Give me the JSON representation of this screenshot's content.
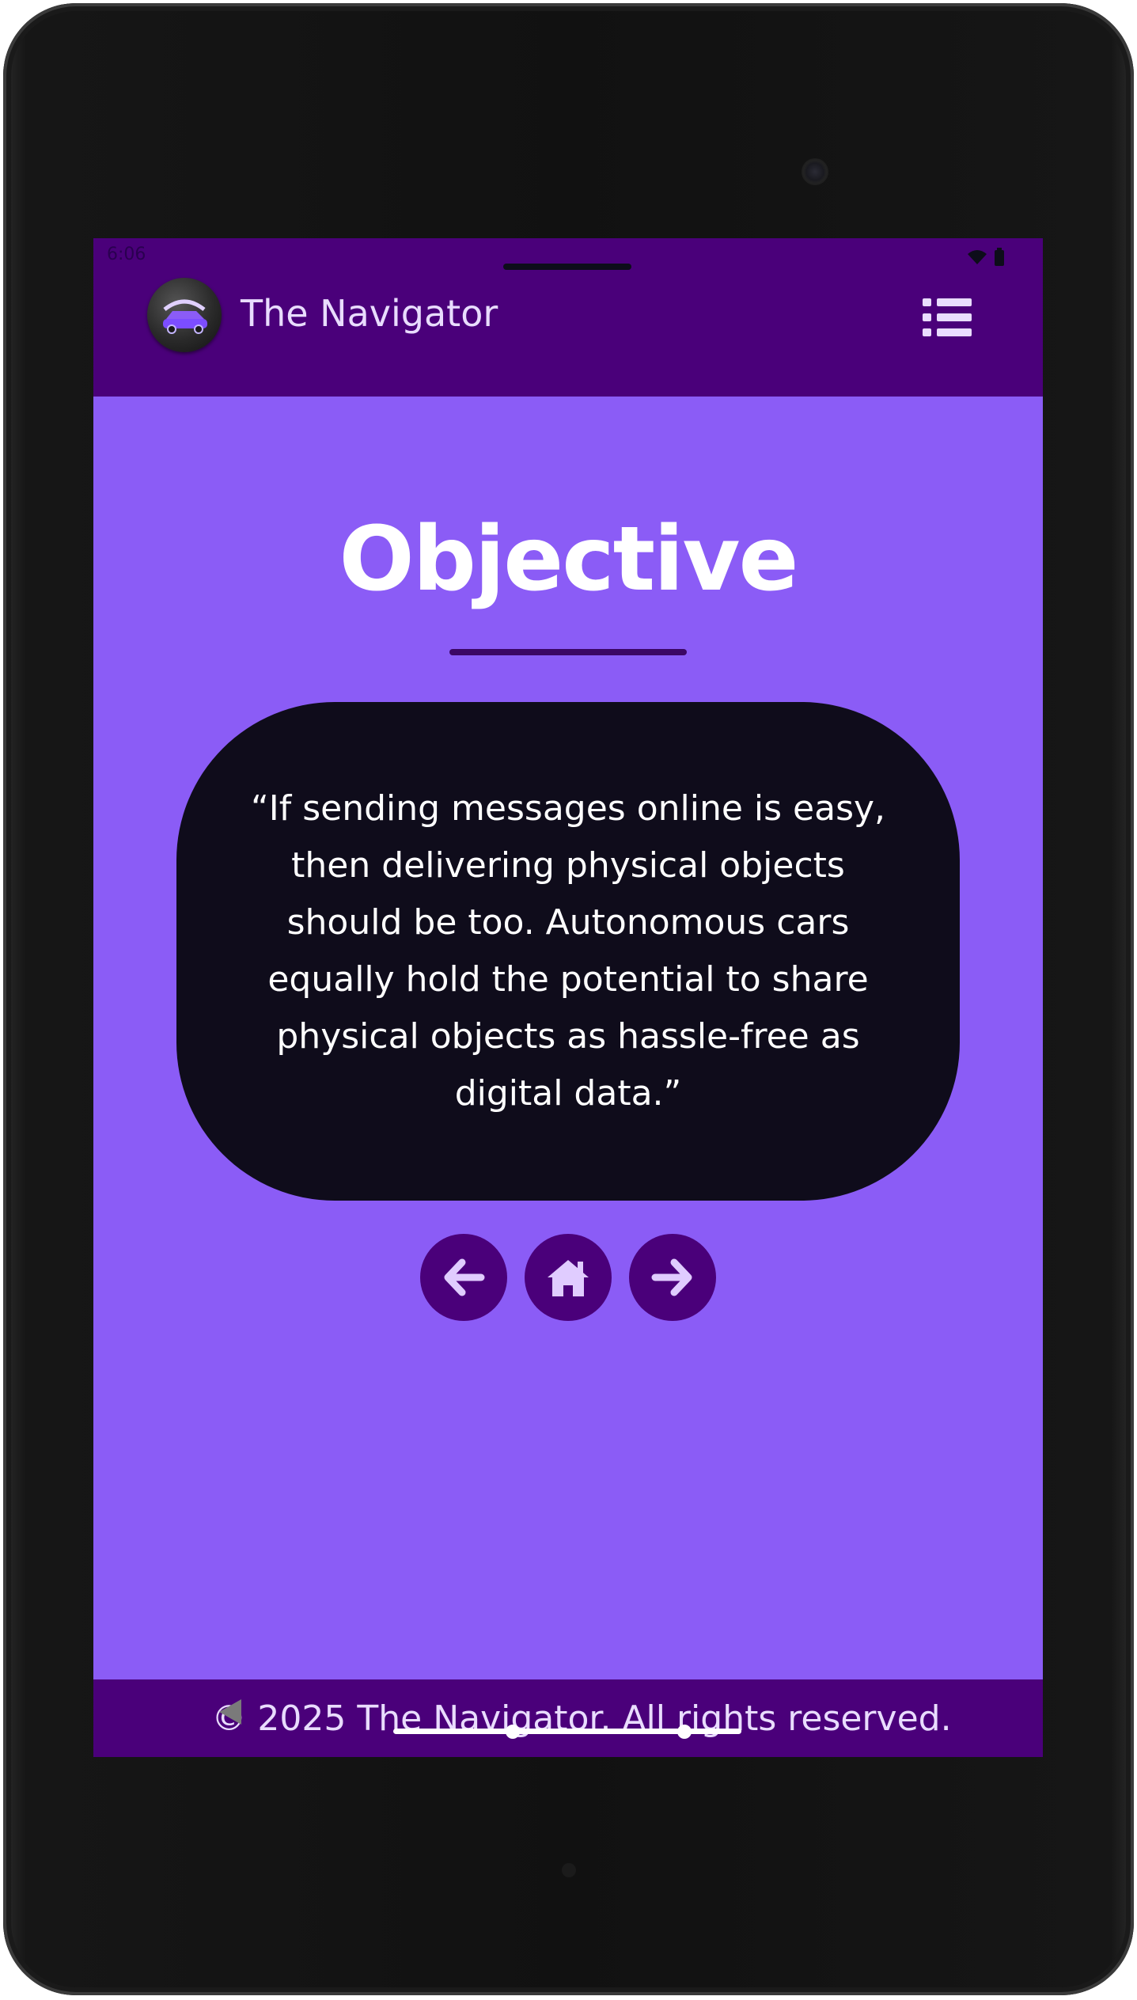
{
  "status_bar": {
    "time": "6:06",
    "icons": [
      "wifi-icon",
      "battery-icon"
    ]
  },
  "header": {
    "app_title": "The Navigator",
    "logo_icon": "car-logo-icon",
    "menu_icon": "list-menu-icon"
  },
  "main": {
    "title": "Objective",
    "quote": "“If sending messages online is easy, then delivering physical objects should be too. Autonomous cars equally hold the potential to share physical objects as hassle-free as digital data.”",
    "nav_buttons": [
      {
        "icon": "arrow-left-icon"
      },
      {
        "icon": "home-icon"
      },
      {
        "icon": "arrow-right-icon"
      }
    ]
  },
  "footer": {
    "text": "© 2025 The Navigator. All rights reserved."
  },
  "colors": {
    "header_bg": "#4a007a",
    "page_bg": "#8b5cf6",
    "card_bg": "#0f0c1b",
    "accent_text": "#e9dcff"
  }
}
